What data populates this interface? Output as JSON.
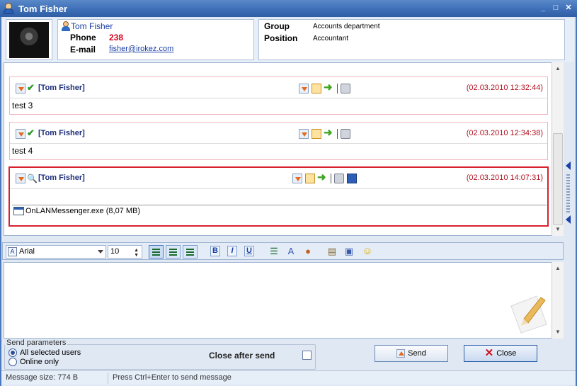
{
  "window": {
    "title": "Tom Fisher"
  },
  "contact": {
    "name": "Tom Fisher",
    "phone_label": "Phone",
    "phone": "238",
    "email_label": "E-mail",
    "email": "fisher@irokez.com",
    "group_label": "Group",
    "group": "Accounts department",
    "position_label": "Position",
    "position": "Accountant"
  },
  "history": {
    "messages": [
      {
        "author": "[Tom Fisher]",
        "time": "(02.03.2010 12:32:44)",
        "text": "test 3",
        "status": "check-icon"
      },
      {
        "author": "[Tom Fisher]",
        "time": "(02.03.2010 12:34:38)",
        "text": "test 4",
        "status": "check-icon"
      },
      {
        "author": "[Tom Fisher]",
        "time": "(02.03.2010 14:07:31)",
        "text": "",
        "status": "magnifier-icon",
        "attachment": "OnLANMessenger.exe (8,07 MB)"
      }
    ]
  },
  "toolbar": {
    "font": "Arial",
    "size": "10",
    "bold": "B",
    "italic": "I",
    "underline": "U"
  },
  "params": {
    "legend": "Send parameters",
    "option_all": "All selected users",
    "option_online": "Online only",
    "selected": "All selected users",
    "close_after_send": "Close after send",
    "close_after_send_checked": false
  },
  "buttons": {
    "send": "Send",
    "close": "Close"
  },
  "status": {
    "size": "Message size: 774 B",
    "hint": "Press Ctrl+Enter to send message"
  },
  "colors": {
    "accent": "#4a79bd",
    "selected_border": "#d8202e",
    "time": "#b01221",
    "phone": "#d4001a"
  }
}
